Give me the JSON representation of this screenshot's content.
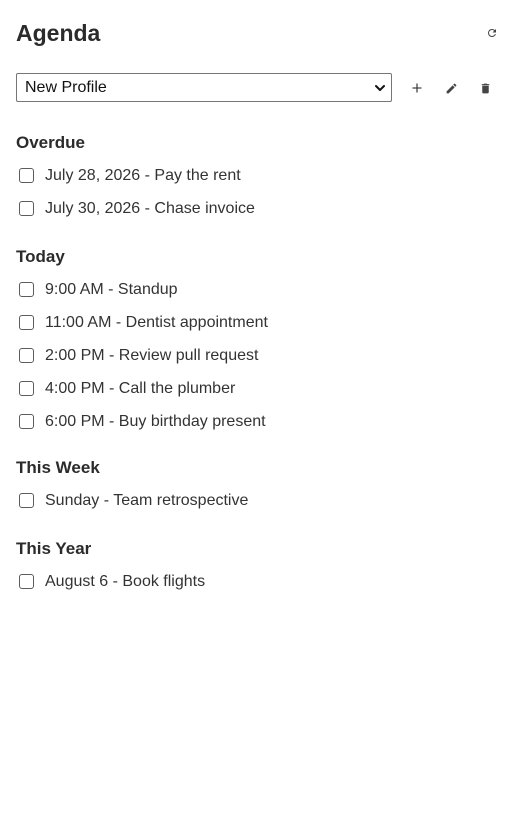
{
  "header": {
    "title": "Agenda",
    "refresh_icon": "refresh-icon"
  },
  "profile": {
    "selected": "New Profile",
    "add_icon": "plus-icon",
    "edit_icon": "pencil-icon",
    "delete_icon": "trash-icon"
  },
  "sections": [
    {
      "title": "Overdue",
      "items": [
        "July 28, 2026 - Pay the rent",
        "July 30, 2026 - Chase invoice"
      ]
    },
    {
      "title": "Today",
      "items": [
        "9:00 AM - Standup",
        "11:00 AM - Dentist appointment",
        "2:00 PM - Review pull request",
        "4:00 PM - Call the plumber",
        "6:00 PM - Buy birthday present"
      ]
    },
    {
      "title": "This Week",
      "items": [
        "Sunday - Team retrospective"
      ]
    },
    {
      "title": "This Year",
      "items": [
        "August 6 - Book flights"
      ]
    }
  ]
}
